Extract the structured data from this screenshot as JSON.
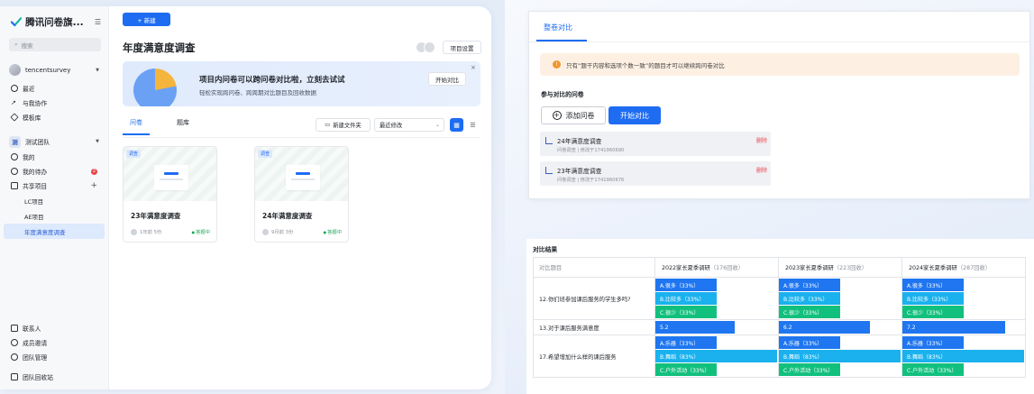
{
  "colors": {
    "primary": "#1e6cf2",
    "barA": "#1f76f0",
    "barB": "#1ab1ee",
    "barC": "#12c07d",
    "danger": "#e5484d"
  },
  "sidebar": {
    "app_name": "腾讯问卷旗...",
    "search_placeholder": "搜索",
    "user": "tencentsurvey",
    "nav": [
      "最近",
      "与我协作",
      "模板库"
    ],
    "team": {
      "badge": "测",
      "name": "测试团队"
    },
    "team_nav": {
      "mine": "我的",
      "todo": "我的待办",
      "todo_count": "2",
      "shared": "共享项目"
    },
    "projects": [
      "LC项目",
      "AE项目",
      "年度满意度调查"
    ],
    "bottom": [
      "联系人",
      "成员邀请",
      "团队管理",
      "团队回收站"
    ]
  },
  "main": {
    "new_button": "+ 新建",
    "title": "年度满意度调查",
    "settings_button": "项目设置",
    "banner": {
      "title": "项目内问卷可以跨问卷对比啦，立刻去试试",
      "subtitle": "轻松实现跨问卷、跨周期对比题目及回收数据",
      "button": "开始对比",
      "close": "×"
    },
    "tabs": [
      "问卷",
      "题库"
    ],
    "new_folder": "新建文件夹",
    "sort": "最近修改",
    "cards": [
      {
        "tag": "调查",
        "title": "23年满意度调查",
        "meta": "1年前 5份",
        "status": "答题中"
      },
      {
        "tag": "调查",
        "title": "24年满意度调查",
        "meta": "9月前 3份",
        "status": "答题中"
      }
    ]
  },
  "compare": {
    "tab": "整卷对比",
    "warning": "只有“题干内容和选项个数一致”的题目才可以继续跨问卷对比",
    "participants_label": "参与对比的问卷",
    "add_button": "添加问卷",
    "start_button": "开始对比",
    "items": [
      {
        "title": "24年满意度调查",
        "meta": "问卷调查 | 修改于1741960690",
        "delete": "删除"
      },
      {
        "title": "23年满意度调查",
        "meta": "问卷调查 | 修改于1741960676",
        "delete": "删除"
      }
    ]
  },
  "results": {
    "title": "对比结果",
    "header_first": "对比题目",
    "columns": [
      {
        "name": "2022家长夏季调研",
        "sub": "（176回收）"
      },
      {
        "name": "2023家长夏季调研",
        "sub": "（223回收）"
      },
      {
        "name": "2024家长夏季调研",
        "sub": "（287回收）"
      }
    ],
    "rows": [
      {
        "question": "12.你们班参加课后服务的学生多吗?",
        "cells": [
          [
            {
              "label": "A.很多（33%）",
              "value": 33,
              "c": "A"
            },
            {
              "label": "B.比较多（33%）",
              "value": 33,
              "c": "B"
            },
            {
              "label": "C.很少（33%）",
              "value": 33,
              "c": "C"
            }
          ],
          [
            {
              "label": "A.很多（33%）",
              "value": 33,
              "c": "A"
            },
            {
              "label": "B.比较多（33%）",
              "value": 33,
              "c": "B"
            },
            {
              "label": "C.很少（33%）",
              "value": 33,
              "c": "C"
            }
          ],
          [
            {
              "label": "A.很多（33%）",
              "value": 33,
              "c": "A"
            },
            {
              "label": "B.比较多（33%）",
              "value": 33,
              "c": "B"
            },
            {
              "label": "C.很少（33%）",
              "value": 33,
              "c": "C"
            }
          ]
        ]
      },
      {
        "question": "13.对于课后服务满意度",
        "cells": [
          [
            {
              "label": "5.2",
              "value": 52,
              "c": "A"
            }
          ],
          [
            {
              "label": "6.2",
              "value": 62,
              "c": "A"
            }
          ],
          [
            {
              "label": "7.2",
              "value": 72,
              "c": "A"
            }
          ]
        ]
      },
      {
        "question": "17.希望增加什么样的课后服务",
        "cells": [
          [
            {
              "label": "A.乐器（33%）",
              "value": 33,
              "c": "A"
            },
            {
              "label": "B.舞蹈（83%）",
              "value": 83,
              "c": "B"
            },
            {
              "label": "C.户外活动（33%）",
              "value": 33,
              "c": "C"
            }
          ],
          [
            {
              "label": "A.乐器（33%）",
              "value": 33,
              "c": "A"
            },
            {
              "label": "B.舞蹈（83%）",
              "value": 83,
              "c": "B"
            },
            {
              "label": "C.户外活动（33%）",
              "value": 33,
              "c": "C"
            }
          ],
          [
            {
              "label": "A.乐器（33%）",
              "value": 33,
              "c": "A"
            },
            {
              "label": "B.舞蹈（83%）",
              "value": 83,
              "c": "B"
            },
            {
              "label": "C.户外活动（33%）",
              "value": 33,
              "c": "C"
            }
          ]
        ]
      }
    ]
  }
}
